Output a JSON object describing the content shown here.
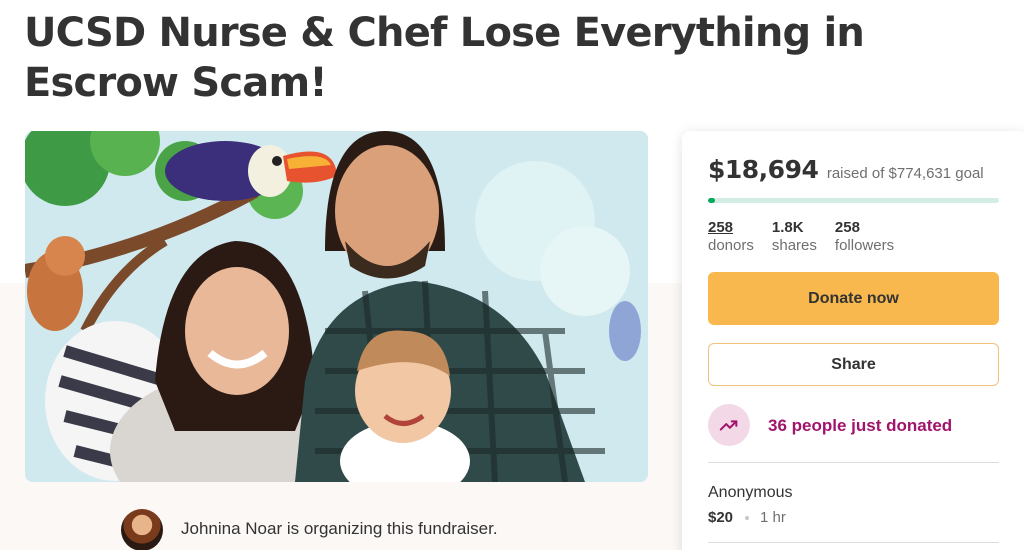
{
  "campaign": {
    "title": "UCSD Nurse & Chef Lose Everything in Escrow Scam!"
  },
  "organizer": {
    "text": "Johnina Noar is organizing this fundraiser."
  },
  "donation_card": {
    "raised": "$18,694",
    "goal_text": "raised of $774,631 goal",
    "progress_fraction": 0.024,
    "stats": [
      {
        "value": "258",
        "label": "donors"
      },
      {
        "value": "1.8K",
        "label": "shares"
      },
      {
        "value": "258",
        "label": "followers"
      }
    ],
    "donate_label": "Donate now",
    "share_label": "Share",
    "recent_activity": "36 people just donated",
    "latest_donation": {
      "name": "Anonymous",
      "amount": "$20",
      "time": "1 hr"
    }
  },
  "colors": {
    "accent_green": "#02a95c",
    "donate_yellow": "#f8b84e",
    "trend_purple": "#a1146d"
  },
  "icons": {
    "trend": "trending-up-icon"
  }
}
